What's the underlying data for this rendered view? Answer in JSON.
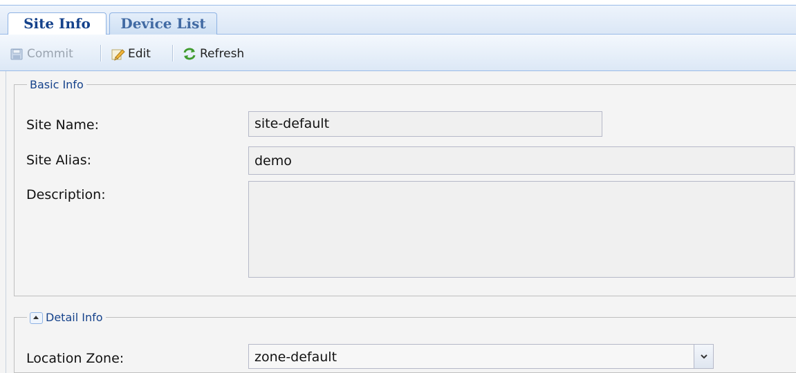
{
  "tabs": [
    {
      "label": "Site Info",
      "active": true
    },
    {
      "label": "Device List",
      "active": false
    }
  ],
  "toolbar": {
    "commit": {
      "label": "Commit",
      "icon": "save-icon",
      "enabled": false
    },
    "edit": {
      "label": "Edit",
      "icon": "pencil-icon",
      "enabled": true
    },
    "refresh": {
      "label": "Refresh",
      "icon": "refresh-icon",
      "enabled": true
    }
  },
  "basic_info": {
    "legend": "Basic Info",
    "site_name": {
      "label": "Site Name:",
      "value": "site-default"
    },
    "site_alias": {
      "label": "Site Alias:",
      "value": "demo"
    },
    "description": {
      "label": "Description:",
      "value": ""
    }
  },
  "detail_info": {
    "legend": "Detail Info",
    "location_zone": {
      "label": "Location Zone:",
      "value": "zone-default"
    }
  },
  "colors": {
    "accent": "#15428b",
    "border": "#99bbe8",
    "field_bg": "#f0f0f0"
  }
}
